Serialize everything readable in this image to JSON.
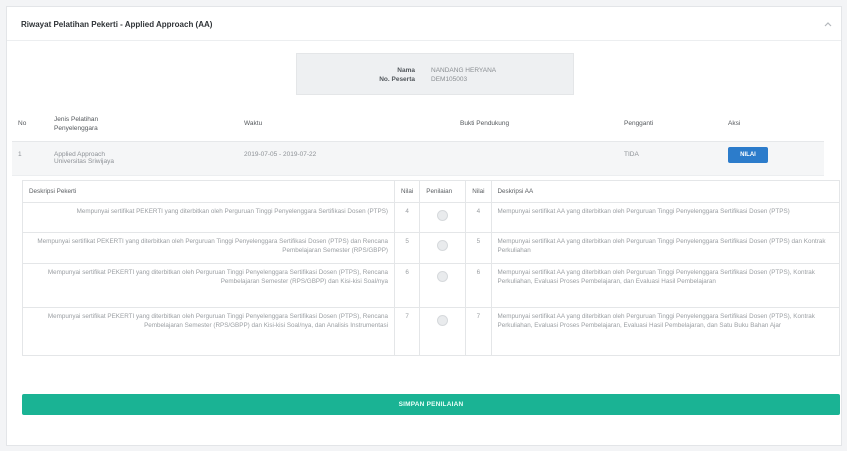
{
  "panel": {
    "title": "Riwayat Pelatihan Pekerti - Applied Approach (AA)"
  },
  "info": {
    "nama_label": "Nama",
    "nama_value": "NANDANG HERYANA",
    "peserta_label": "No. Peserta",
    "peserta_value": "DEM105003"
  },
  "main_table": {
    "headers": [
      "No",
      "Jenis Pelatihan\nPenyelenggara",
      "Waktu",
      "Bukti Pendukung",
      "Pengganti",
      "Aksi"
    ],
    "row": {
      "no": "1",
      "jenis": "Applied Approach",
      "penyelenggara": "Universitas Sriwijaya",
      "waktu": "2019-07-05 - 2019-07-22",
      "bukti": "",
      "pengganti": "TIDA",
      "aksi": "NILAI"
    }
  },
  "sub_table": {
    "headers": [
      "Deskripsi Pekerti",
      "Nilai",
      "Penilaian",
      "Nilai",
      "Deskripsi AA"
    ],
    "rows": [
      {
        "pekerti": "Mempunyai sertifikat PEKERTI yang diterbitkan oleh Perguruan Tinggi Penyelenggara Sertifikasi Dosen (PTPS)",
        "nilai_pekerti": "4",
        "nilai_aa": "4",
        "aa": "Mempunyai sertifikat AA yang diterbitkan oleh Perguruan Tinggi Penyelenggara Sertifikasi Dosen (PTPS)"
      },
      {
        "pekerti": "Mempunyai sertifikat PEKERTI yang diterbitkan oleh Perguruan Tinggi Penyelenggara Sertifikasi Dosen (PTPS) dan Rencana Pembelajaran Semester (RPS/GBPP)",
        "nilai_pekerti": "5",
        "nilai_aa": "5",
        "aa": "Mempunyai sertifikat AA yang diterbitkan oleh Perguruan Tinggi Penyelenggara Sertifikasi Dosen (PTPS) dan Kontrak Perkuliahan"
      },
      {
        "pekerti": "Mempunyai sertifikat PEKERTI yang diterbitkan oleh Perguruan Tinggi Penyelenggara Sertifikasi Dosen (PTPS), Rencana Pembelajaran Semester (RPS/GBPP) dan Kisi-kisi Soal/nya",
        "nilai_pekerti": "6",
        "nilai_aa": "6",
        "aa": "Mempunyai sertifikat AA yang diterbitkan oleh Perguruan Tinggi Penyelenggara Sertifikasi Dosen (PTPS), Kontrak Perkuliahan, Evaluasi Proses Pembelajaran, dan Evaluasi Hasil Pembelajaran"
      },
      {
        "pekerti": "Mempunyai sertifikat PEKERTI yang diterbitkan oleh Perguruan Tinggi Penyelenggara Sertifikasi Dosen (PTPS), Rencana Pembelajaran Semester (RPS/GBPP) dan Kisi-kisi Soal/nya, dan Analisis Instrumentasi",
        "nilai_pekerti": "7",
        "nilai_aa": "7",
        "aa": "Mempunyai sertifikat AA yang diterbitkan oleh Perguruan Tinggi Penyelenggara Sertifikasi Dosen (PTPS), Kontrak Perkuliahan, Evaluasi Proses Pembelajaran, Evaluasi Hasil Pembelajaran, dan Satu Buku Bahan Ajar"
      }
    ]
  },
  "submit_label": "SIMPAN PENILAIAN",
  "icons": {
    "collapse": "chevron-up-icon"
  },
  "colors": {
    "accent": "#1ab394",
    "button_blue": "#2c7ccb"
  }
}
